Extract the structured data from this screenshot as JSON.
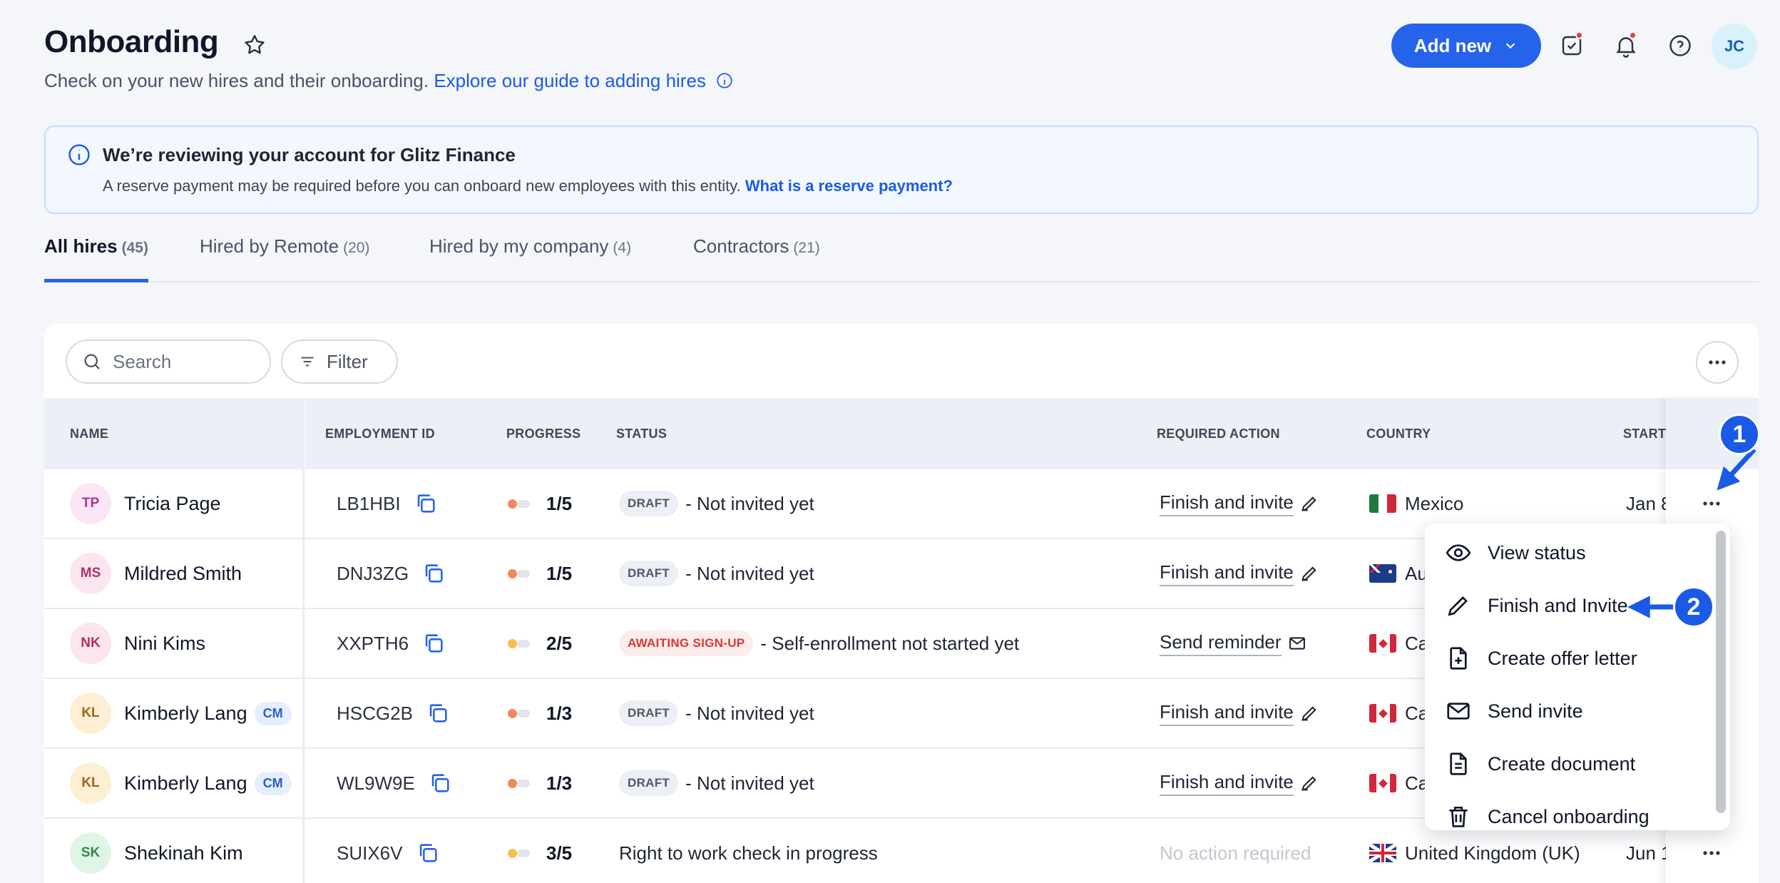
{
  "header": {
    "title": "Onboarding",
    "subtitle": "Check on your new hires and their onboarding.",
    "guide_link": "Explore our guide to adding hires",
    "add_new_label": "Add new",
    "user_initials": "JC"
  },
  "banner": {
    "title": "We’re reviewing your account for Glitz Finance",
    "text": "A reserve payment may be required before you can onboard new employees with this entity.",
    "link": "What is a reserve payment?"
  },
  "tabs": [
    {
      "label": "All hires",
      "count": "(45)"
    },
    {
      "label": "Hired by Remote",
      "count": "(20)"
    },
    {
      "label": "Hired by my company",
      "count": "(4)"
    },
    {
      "label": "Contractors",
      "count": "(21)"
    }
  ],
  "toolbar": {
    "search_placeholder": "Search",
    "filter_label": "Filter"
  },
  "table": {
    "columns": [
      "NAME",
      "EMPLOYMENT ID",
      "PROGRESS",
      "STATUS",
      "REQUIRED ACTION",
      "COUNTRY",
      "START"
    ],
    "rows": [
      {
        "initials": "TP",
        "name": "Tricia Page",
        "cm": "",
        "id": "LB1HBI",
        "progress": "1/5",
        "badge": "DRAFT",
        "status": "- Not invited yet",
        "action": "Finish and invite",
        "country": "Mexico",
        "start": "Jan 8"
      },
      {
        "initials": "MS",
        "name": "Mildred Smith",
        "cm": "",
        "id": "DNJ3ZG",
        "progress": "1/5",
        "badge": "DRAFT",
        "status": "- Not invited yet",
        "action": "Finish and invite",
        "country": "Au",
        "start": ""
      },
      {
        "initials": "NK",
        "name": "Nini Kims",
        "cm": "",
        "id": "XXPTH6",
        "progress": "2/5",
        "badge": "AWAITING SIGN-UP",
        "status": "- Self-enrollment not started yet",
        "action": "Send reminder",
        "country": "Ca",
        "start": ""
      },
      {
        "initials": "KL",
        "name": "Kimberly Lang",
        "cm": "CM",
        "id": "HSCG2B",
        "progress": "1/3",
        "badge": "DRAFT",
        "status": "- Not invited yet",
        "action": "Finish and invite",
        "country": "Ca",
        "start": ""
      },
      {
        "initials": "KL",
        "name": "Kimberly Lang",
        "cm": "CM",
        "id": "WL9W9E",
        "progress": "1/3",
        "badge": "DRAFT",
        "status": "- Not invited yet",
        "action": "Finish and invite",
        "country": "Ca",
        "start": ""
      },
      {
        "initials": "SK",
        "name": "Shekinah Kim",
        "cm": "",
        "id": "SUIX6V",
        "progress": "3/5",
        "badge": "",
        "status": "Right to work check in progress",
        "action": "No action required",
        "country": "United Kingdom (UK)",
        "start": "Jun 1"
      }
    ]
  },
  "menu": {
    "items": [
      "View status",
      "Finish and Invite",
      "Create offer letter",
      "Send invite",
      "Create document",
      "Cancel onboarding"
    ]
  },
  "annotations": {
    "step1": "1",
    "step2": "2"
  },
  "colors": {
    "accent": "#2563eb",
    "draft_badge": "#eceff5",
    "awaiting_badge": "#fdecec",
    "annotation": "#1a5ae6"
  }
}
